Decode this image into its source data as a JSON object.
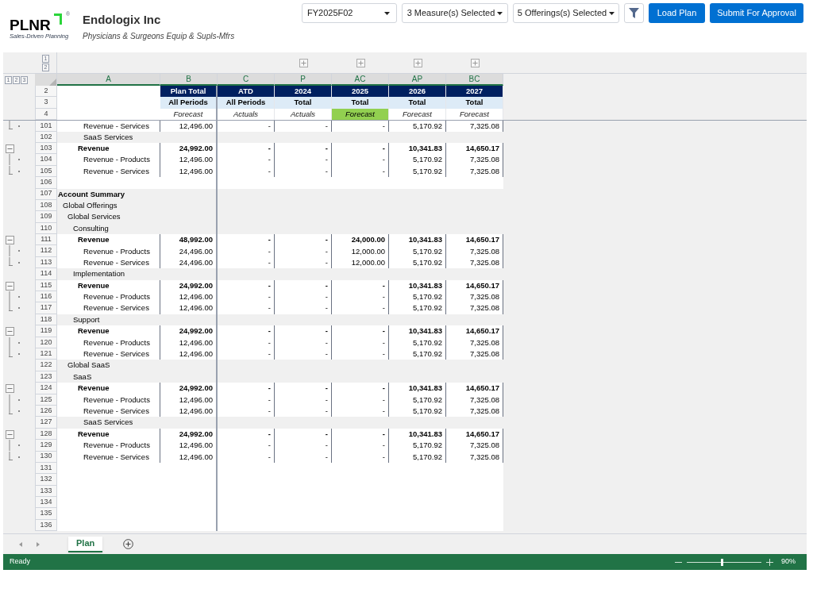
{
  "header": {
    "logo": {
      "text": "PLNR",
      "mark": "®",
      "tagline": "Sales-Driven Planning"
    },
    "company": "Endologix Inc",
    "industry": "Physicians & Surgeons Equip & Supls-Mfrs",
    "selects": [
      {
        "value": "FY2025F02",
        "kind": "wide"
      },
      {
        "value": "3 Measure(s) Selected",
        "kind": "narrow"
      },
      {
        "value": "5 Offerings(s) Selected",
        "kind": "narrow"
      }
    ],
    "buttons": [
      "Load Plan",
      "Submit For Approval"
    ]
  },
  "sheet": {
    "row_levels": [
      "1",
      "2"
    ],
    "column_levels": [
      "1",
      "2",
      "3"
    ],
    "columns": [
      {
        "letter": "A",
        "expand_button": false
      },
      {
        "letter": "B",
        "expand_button": false
      },
      {
        "letter": "C",
        "expand_button": false
      },
      {
        "letter": "P",
        "expand_button": true
      },
      {
        "letter": "AC",
        "expand_button": true
      },
      {
        "letter": "AP",
        "expand_button": true
      },
      {
        "letter": "BC",
        "expand_button": true
      }
    ],
    "header_rows": [
      {
        "row": "2",
        "kind": "title",
        "cells": [
          {
            "text": "Plan Total",
            "highlighted": false
          },
          {
            "text": "ATD",
            "highlighted": false
          },
          {
            "text": "2024",
            "highlighted": false
          },
          {
            "text": "2025",
            "highlighted": false
          },
          {
            "text": "2026",
            "highlighted": false
          },
          {
            "text": "2027",
            "highlighted": false
          }
        ]
      },
      {
        "row": "3",
        "kind": "period",
        "cells": [
          {
            "text": "All Periods",
            "highlighted": false
          },
          {
            "text": "All Periods",
            "highlighted": false
          },
          {
            "text": "Total",
            "highlighted": false
          },
          {
            "text": "Total",
            "highlighted": false
          },
          {
            "text": "Total",
            "highlighted": false
          },
          {
            "text": "Total",
            "highlighted": false
          }
        ]
      },
      {
        "row": "4",
        "kind": "type",
        "cells": [
          {
            "text": "Forecast",
            "highlighted": false
          },
          {
            "text": "Actuals",
            "highlighted": false
          },
          {
            "text": "Actuals",
            "highlighted": false
          },
          {
            "text": "Forecast",
            "highlighted": true
          },
          {
            "text": "Forecast",
            "highlighted": false
          },
          {
            "text": "Forecast",
            "highlighted": false
          }
        ]
      }
    ],
    "rows": [
      {
        "row": "101",
        "kind": "line",
        "collapse_button": false,
        "in_group": true,
        "group_end": true,
        "label": "Revenue - Services",
        "values": [
          "12,496.00",
          "-",
          "-",
          "-",
          "5,170.92",
          "7,325.08"
        ]
      },
      {
        "row": "102",
        "kind": "subgroup",
        "collapse_button": false,
        "in_group": false,
        "group_end": false,
        "label": "SaaS Services"
      },
      {
        "row": "103",
        "kind": "total",
        "collapse_button": true,
        "in_group": false,
        "group_end": false,
        "label": "Revenue",
        "values": [
          "24,992.00",
          "-",
          "-",
          "-",
          "10,341.83",
          "14,650.17"
        ]
      },
      {
        "row": "104",
        "kind": "line",
        "collapse_button": false,
        "in_group": true,
        "group_end": false,
        "label": "Revenue - Products",
        "values": [
          "12,496.00",
          "-",
          "-",
          "-",
          "5,170.92",
          "7,325.08"
        ]
      },
      {
        "row": "105",
        "kind": "line",
        "collapse_button": false,
        "in_group": true,
        "group_end": true,
        "label": "Revenue - Services",
        "values": [
          "12,496.00",
          "-",
          "-",
          "-",
          "5,170.92",
          "7,325.08"
        ]
      },
      {
        "row": "106",
        "kind": "blank",
        "collapse_button": false,
        "in_group": false,
        "group_end": false
      },
      {
        "row": "107",
        "kind": "summary",
        "collapse_button": false,
        "in_group": false,
        "group_end": false,
        "label": "Account Summary"
      },
      {
        "row": "108",
        "kind": "offering",
        "collapse_button": false,
        "in_group": false,
        "group_end": false,
        "label": "Global Offerings"
      },
      {
        "row": "109",
        "kind": "service",
        "collapse_button": false,
        "in_group": false,
        "group_end": false,
        "label": "Global Services"
      },
      {
        "row": "110",
        "kind": "group",
        "collapse_button": false,
        "in_group": false,
        "group_end": false,
        "label": "Consulting"
      },
      {
        "row": "111",
        "kind": "total",
        "collapse_button": true,
        "in_group": false,
        "group_end": false,
        "label": "Revenue",
        "values": [
          "48,992.00",
          "-",
          "-",
          "24,000.00",
          "10,341.83",
          "14,650.17"
        ]
      },
      {
        "row": "112",
        "kind": "line",
        "collapse_button": false,
        "in_group": true,
        "group_end": false,
        "label": "Revenue - Products",
        "values": [
          "24,496.00",
          "-",
          "-",
          "12,000.00",
          "5,170.92",
          "7,325.08"
        ]
      },
      {
        "row": "113",
        "kind": "line",
        "collapse_button": false,
        "in_group": true,
        "group_end": true,
        "label": "Revenue - Services",
        "values": [
          "24,496.00",
          "-",
          "-",
          "12,000.00",
          "5,170.92",
          "7,325.08"
        ]
      },
      {
        "row": "114",
        "kind": "group",
        "collapse_button": false,
        "in_group": false,
        "group_end": false,
        "label": "Implementation"
      },
      {
        "row": "115",
        "kind": "total",
        "collapse_button": true,
        "in_group": false,
        "group_end": false,
        "label": "Revenue",
        "values": [
          "24,992.00",
          "-",
          "-",
          "-",
          "10,341.83",
          "14,650.17"
        ]
      },
      {
        "row": "116",
        "kind": "line",
        "collapse_button": false,
        "in_group": true,
        "group_end": false,
        "label": "Revenue - Products",
        "values": [
          "12,496.00",
          "-",
          "-",
          "-",
          "5,170.92",
          "7,325.08"
        ]
      },
      {
        "row": "117",
        "kind": "line",
        "collapse_button": false,
        "in_group": true,
        "group_end": true,
        "label": "Revenue - Services",
        "values": [
          "12,496.00",
          "-",
          "-",
          "-",
          "5,170.92",
          "7,325.08"
        ]
      },
      {
        "row": "118",
        "kind": "group",
        "collapse_button": false,
        "in_group": false,
        "group_end": false,
        "label": "Support"
      },
      {
        "row": "119",
        "kind": "total",
        "collapse_button": true,
        "in_group": false,
        "group_end": false,
        "label": "Revenue",
        "values": [
          "24,992.00",
          "-",
          "-",
          "-",
          "10,341.83",
          "14,650.17"
        ]
      },
      {
        "row": "120",
        "kind": "line",
        "collapse_button": false,
        "in_group": true,
        "group_end": false,
        "label": "Revenue - Products",
        "values": [
          "12,496.00",
          "-",
          "-",
          "-",
          "5,170.92",
          "7,325.08"
        ]
      },
      {
        "row": "121",
        "kind": "line",
        "collapse_button": false,
        "in_group": true,
        "group_end": true,
        "label": "Revenue - Services",
        "values": [
          "12,496.00",
          "-",
          "-",
          "-",
          "5,170.92",
          "7,325.08"
        ]
      },
      {
        "row": "122",
        "kind": "service",
        "collapse_button": false,
        "in_group": false,
        "group_end": false,
        "label": "Global SaaS"
      },
      {
        "row": "123",
        "kind": "group",
        "collapse_button": false,
        "in_group": false,
        "group_end": false,
        "label": "SaaS"
      },
      {
        "row": "124",
        "kind": "total",
        "collapse_button": true,
        "in_group": false,
        "group_end": false,
        "label": "Revenue",
        "values": [
          "24,992.00",
          "-",
          "-",
          "-",
          "10,341.83",
          "14,650.17"
        ]
      },
      {
        "row": "125",
        "kind": "line",
        "collapse_button": false,
        "in_group": true,
        "group_end": false,
        "label": "Revenue - Products",
        "values": [
          "12,496.00",
          "-",
          "-",
          "-",
          "5,170.92",
          "7,325.08"
        ]
      },
      {
        "row": "126",
        "kind": "line",
        "collapse_button": false,
        "in_group": true,
        "group_end": true,
        "label": "Revenue - Services",
        "values": [
          "12,496.00",
          "-",
          "-",
          "-",
          "5,170.92",
          "7,325.08"
        ]
      },
      {
        "row": "127",
        "kind": "subgroup",
        "collapse_button": false,
        "in_group": false,
        "group_end": false,
        "label": "SaaS Services"
      },
      {
        "row": "128",
        "kind": "total",
        "collapse_button": true,
        "in_group": false,
        "group_end": false,
        "label": "Revenue",
        "values": [
          "24,992.00",
          "-",
          "-",
          "-",
          "10,341.83",
          "14,650.17"
        ]
      },
      {
        "row": "129",
        "kind": "line",
        "collapse_button": false,
        "in_group": true,
        "group_end": false,
        "label": "Revenue - Products",
        "values": [
          "12,496.00",
          "-",
          "-",
          "-",
          "5,170.92",
          "7,325.08"
        ]
      },
      {
        "row": "130",
        "kind": "line",
        "collapse_button": false,
        "in_group": true,
        "group_end": true,
        "label": "Revenue - Services",
        "values": [
          "12,496.00",
          "-",
          "-",
          "-",
          "5,170.92",
          "7,325.08"
        ]
      },
      {
        "row": "131",
        "kind": "blank",
        "collapse_button": false,
        "in_group": false,
        "group_end": false
      },
      {
        "row": "132",
        "kind": "blank",
        "collapse_button": false,
        "in_group": false,
        "group_end": false
      },
      {
        "row": "133",
        "kind": "blank",
        "collapse_button": false,
        "in_group": false,
        "group_end": false
      },
      {
        "row": "134",
        "kind": "blank",
        "collapse_button": false,
        "in_group": false,
        "group_end": false
      },
      {
        "row": "135",
        "kind": "blank",
        "collapse_button": false,
        "in_group": false,
        "group_end": false
      },
      {
        "row": "136",
        "kind": "blank",
        "collapse_button": false,
        "in_group": false,
        "group_end": false
      }
    ]
  },
  "tabs": [
    {
      "label": "Plan",
      "selected": true
    }
  ],
  "status_bar": {
    "status": "Ready",
    "zoom": {
      "level": 0.47,
      "reading": "90%"
    }
  }
}
